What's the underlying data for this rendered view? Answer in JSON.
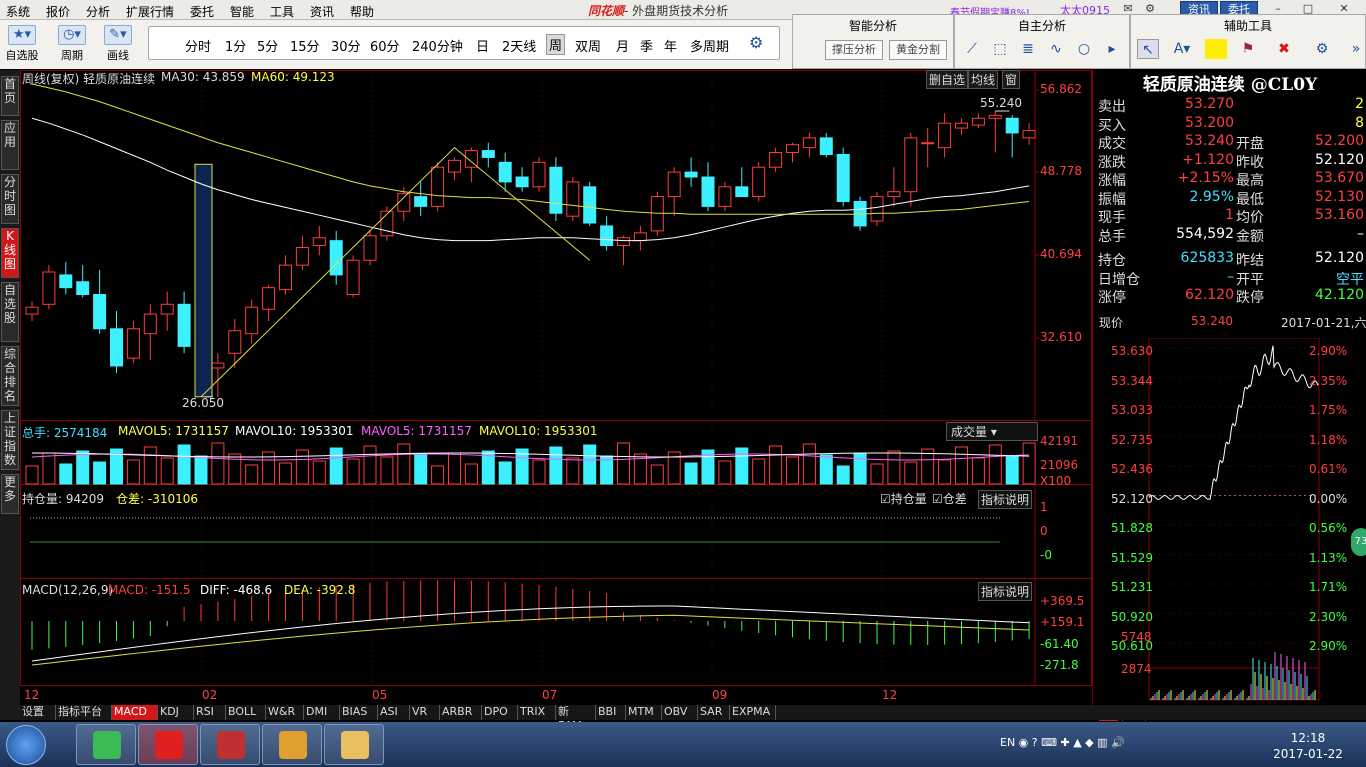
{
  "menubar": {
    "items": [
      "系统",
      "报价",
      "分析",
      "扩展行情",
      "委托",
      "智能",
      "工具",
      "资讯",
      "帮助"
    ],
    "app_logo": "同花顺",
    "app_title": "- 外盘期货技术分析",
    "promo": "春节假期宝赚8%!",
    "user": "太太0915",
    "btn_news": "资讯",
    "btn_trade": "委托"
  },
  "toolbar": {
    "tools": [
      {
        "label": "自选股"
      },
      {
        "label": "周期"
      },
      {
        "label": "画线"
      }
    ],
    "periods": [
      "分时",
      "1分",
      "5分",
      "15分",
      "30分",
      "60分",
      "240分钟",
      "日",
      "2天线",
      "周",
      "双周",
      "月",
      "季",
      "年",
      "多周期"
    ],
    "selected_period": "周",
    "smart_title": "智能分析",
    "smart_btns": [
      "撑压分析",
      "黄金分割"
    ],
    "custom_title": "自主分析",
    "aux_title": "辅助工具"
  },
  "lefttabs": [
    "首页",
    "应用",
    "分时图",
    "K线图",
    "自选股",
    "综合排名",
    "上证指数",
    "更多"
  ],
  "kline": {
    "header": "周线(复权)  轻质原油连续  MA30: 43.859",
    "ma30": "MA30: 43.859",
    "ma60": "MA60: 49.123",
    "title_prefix": "周线(复权)  轻质原油连续",
    "btn_fav": "删自选",
    "btn_avg": "均线",
    "btn_win": "窗",
    "yticks": [
      "56.862",
      "48.778",
      "40.694",
      "32.610"
    ],
    "high_label": "55.240",
    "low_label": "26.050",
    "xlabels": [
      "12",
      "02",
      "05",
      "07",
      "09",
      "12"
    ]
  },
  "volume": {
    "total": "总手: 2574184",
    "mavol5": "MAVOL5: 1731157",
    "mavol10": "MAVOL10: 1953301",
    "mavol5b": "MAVOL5: 1731157",
    "mavol10b": "MAVOL10: 1953301",
    "selector": "成交量",
    "yticks": [
      "42191",
      "21096",
      "X100"
    ]
  },
  "oi": {
    "label": "持仓量: 94209",
    "diff": "仓差: -310106",
    "chk1": "持仓量",
    "chk2": "仓差",
    "explain": "指标说明",
    "yticks": [
      "1",
      "0",
      "-0"
    ]
  },
  "macd": {
    "title": "MACD(12,26,9)",
    "macd": "MACD: -151.5",
    "diff": "DIFF: -468.6",
    "dea": "DEA: -392.8",
    "explain": "指标说明",
    "yticks": [
      "+369.5",
      "+159.1",
      "-61.40",
      "-271.8"
    ]
  },
  "quote": {
    "title": "轻质原油连续 @CL0Y",
    "rows": [
      {
        "l": "卖出",
        "v": "53.270",
        "r": "",
        "rv": "2",
        "vc": "#ff4040",
        "rc": "#ffff40"
      },
      {
        "l": "买入",
        "v": "53.200",
        "r": "",
        "rv": "8",
        "vc": "#ff4040",
        "rc": "#ffff40"
      },
      {
        "l": "成交",
        "v": "53.240",
        "r": "开盘",
        "rv": "52.200",
        "vc": "#ff4040",
        "rc": "#ff4040"
      },
      {
        "l": "涨跌",
        "v": "+1.120",
        "r": "昨收",
        "rv": "52.120",
        "vc": "#ff4040",
        "rc": "#ffffff"
      },
      {
        "l": "涨幅",
        "v": "+2.15%",
        "r": "最高",
        "rv": "53.670",
        "vc": "#ff4040",
        "rc": "#ff4040"
      },
      {
        "l": "振幅",
        "v": "2.95%",
        "r": "最低",
        "rv": "52.130",
        "vc": "#40e0ff",
        "rc": "#ff4040"
      },
      {
        "l": "现手",
        "v": "1",
        "r": "均价",
        "rv": "53.160",
        "vc": "#ff4040",
        "rc": "#ff4040"
      },
      {
        "l": "总手",
        "v": "554,592",
        "r": "金额",
        "rv": "–",
        "vc": "#ffffff",
        "rc": "#ffffff"
      },
      {
        "l": "持仓",
        "v": "625833",
        "r": "昨结",
        "rv": "52.120",
        "vc": "#40e0ff",
        "rc": "#ffffff"
      },
      {
        "l": "日增仓",
        "v": "–",
        "r": "开平",
        "rv": "空平",
        "vc": "#40e0ff",
        "rc": "#40e0ff"
      },
      {
        "l": "涨停",
        "v": "62.120",
        "r": "跌停",
        "rv": "42.120",
        "vc": "#ff4040",
        "rc": "#40ff40"
      }
    ],
    "now_label": "现价",
    "now_value": "53.240",
    "date": "2017-01-21,六",
    "price_ticks": [
      "53.630",
      "53.344",
      "53.033",
      "52.735",
      "52.436",
      "52.120",
      "51.828",
      "51.529",
      "51.231",
      "50.920",
      "50.610"
    ],
    "pct_ticks": [
      "2.90%",
      "2.35%",
      "1.75%",
      "1.18%",
      "0.61%",
      "0.00%",
      "0.56%",
      "1.13%",
      "1.71%",
      "2.30%",
      "2.90%"
    ],
    "vol_ticks": [
      "5748",
      "2874"
    ],
    "badge": "73",
    "tabs": [
      "分",
      "筹",
      "焰"
    ]
  },
  "bottomtabs": [
    "设置",
    "指标平台",
    "MACD",
    "KDJ",
    "RSI",
    "BOLL",
    "W&R",
    "DMI",
    "BIAS",
    "ASI",
    "VR",
    "ARBR",
    "DPO",
    "TRIX",
    "新DMA",
    "BBI",
    "MTM",
    "OBV",
    "SAR",
    "EXPMA"
  ],
  "selected_tab": "MACD",
  "taskbar": {
    "time": "12:18",
    "date": "2017-01-22",
    "lang": "EN"
  },
  "chart_data": {
    "type": "candlestick",
    "period": "weekly",
    "symbol": "轻质原油连续",
    "yrange": [
      24.5,
      58
    ],
    "ohlc": [
      [
        34.5,
        35.8,
        33.8,
        35.2
      ],
      [
        35.5,
        39.5,
        35.0,
        38.8
      ],
      [
        38.5,
        39.8,
        36.5,
        37.2
      ],
      [
        37.8,
        39.5,
        36.2,
        36.5
      ],
      [
        36.5,
        39.0,
        32.5,
        33.0
      ],
      [
        33.0,
        34.8,
        28.5,
        29.2
      ],
      [
        30.0,
        33.8,
        29.5,
        33.0
      ],
      [
        32.5,
        35.5,
        29.8,
        34.5
      ],
      [
        34.5,
        36.8,
        32.8,
        35.5
      ],
      [
        35.5,
        36.8,
        30.5,
        31.2
      ],
      [
        31.0,
        32.5,
        27.5,
        28.5
      ],
      [
        29.0,
        30.5,
        26.05,
        29.5
      ],
      [
        30.5,
        34.0,
        29.0,
        32.8
      ],
      [
        32.5,
        36.0,
        31.5,
        35.2
      ],
      [
        35.0,
        37.5,
        33.8,
        37.2
      ],
      [
        37.0,
        40.5,
        36.5,
        39.5
      ],
      [
        39.5,
        42.5,
        39.0,
        41.3
      ],
      [
        41.5,
        43.5,
        40.5,
        42.3
      ],
      [
        42.0,
        43.0,
        37.5,
        38.5
      ],
      [
        36.5,
        40.5,
        36.2,
        40.0
      ],
      [
        40.0,
        43.0,
        39.5,
        42.5
      ],
      [
        42.5,
        45.5,
        42.0,
        45.0
      ],
      [
        45.0,
        47.5,
        44.0,
        46.8
      ],
      [
        46.5,
        48.0,
        44.5,
        45.5
      ],
      [
        45.5,
        50.0,
        45.0,
        49.5
      ],
      [
        49.0,
        50.5,
        48.2,
        50.2
      ],
      [
        49.5,
        51.5,
        48.0,
        51.2
      ],
      [
        51.2,
        52.0,
        49.5,
        50.5
      ],
      [
        50.0,
        51.0,
        47.0,
        48.0
      ],
      [
        48.5,
        49.5,
        47.0,
        47.5
      ],
      [
        47.5,
        50.5,
        47.0,
        50.0
      ],
      [
        49.5,
        50.5,
        44.0,
        44.8
      ],
      [
        44.5,
        48.5,
        44.0,
        48.0
      ],
      [
        47.5,
        48.0,
        43.5,
        43.8
      ],
      [
        43.5,
        44.5,
        41.0,
        41.5
      ],
      [
        41.5,
        42.5,
        39.5,
        42.3
      ],
      [
        42.0,
        43.5,
        41.0,
        42.8
      ],
      [
        43.0,
        47.0,
        42.5,
        46.5
      ],
      [
        46.5,
        49.5,
        44.5,
        49.0
      ],
      [
        49.0,
        50.5,
        47.5,
        48.5
      ],
      [
        48.5,
        50.0,
        45.0,
        45.5
      ],
      [
        45.5,
        48.0,
        45.0,
        47.5
      ],
      [
        47.5,
        49.5,
        46.5,
        46.5
      ],
      [
        46.5,
        50.0,
        46.0,
        49.5
      ],
      [
        49.5,
        51.5,
        49.0,
        51.0
      ],
      [
        51.0,
        52.0,
        50.0,
        51.8
      ],
      [
        51.5,
        53.0,
        50.5,
        52.5
      ],
      [
        52.5,
        53.0,
        50.5,
        50.8
      ],
      [
        50.8,
        51.5,
        45.5,
        46.0
      ],
      [
        46.0,
        46.5,
        43.0,
        43.5
      ],
      [
        44.0,
        47.0,
        43.5,
        46.5
      ],
      [
        46.5,
        49.5,
        45.5,
        47.0
      ],
      [
        47.0,
        53.0,
        45.5,
        52.5
      ],
      [
        52.0,
        53.5,
        49.5,
        52.0
      ],
      [
        51.5,
        55.0,
        50.5,
        54.0
      ],
      [
        53.5,
        54.5,
        52.8,
        54.0
      ],
      [
        53.8,
        55.0,
        53.5,
        54.5
      ],
      [
        54.5,
        55.24,
        51.0,
        54.8
      ],
      [
        54.5,
        54.8,
        50.5,
        53.0
      ],
      [
        52.5,
        54.0,
        51.8,
        53.24
      ]
    ],
    "ma30": [
      54.5,
      54.0,
      53.4,
      52.8,
      52.1,
      51.4,
      50.7,
      50.0,
      49.2,
      48.5,
      47.8,
      47.2,
      46.7,
      46.2,
      45.8,
      45.4,
      45.0,
      44.6,
      44.2,
      43.8,
      43.4,
      43.0,
      42.6,
      42.3,
      42.1,
      42.0,
      42.0,
      42.0,
      42.1,
      42.2,
      42.3,
      42.3,
      42.3,
      42.2,
      42.1,
      42.0,
      42.0,
      42.1,
      42.3,
      42.6,
      43.0,
      43.4,
      43.8,
      44.2,
      44.5,
      44.8,
      45.0,
      45.1,
      45.1,
      45.2,
      45.4,
      45.7,
      46.0,
      46.3,
      46.5,
      46.6,
      46.8,
      47.0,
      47.3,
      47.6
    ],
    "ma60": [
      58.0,
      57.6,
      57.2,
      56.7,
      56.2,
      55.6,
      55.0,
      54.4,
      53.8,
      53.2,
      52.6,
      52.0,
      51.5,
      51.0,
      50.5,
      50.0,
      49.5,
      49.0,
      48.5,
      48.0,
      47.6,
      47.3,
      47.0,
      46.8,
      46.6,
      46.5,
      46.4,
      46.4,
      46.3,
      46.2,
      46.0,
      45.8,
      45.6,
      45.4,
      45.2,
      45.0,
      44.9,
      44.8,
      44.8,
      44.7,
      44.7,
      44.7,
      44.7,
      44.7,
      44.7,
      44.7,
      44.7,
      44.7,
      44.7,
      44.7,
      44.8,
      44.8,
      44.9,
      45.0,
      45.1,
      45.2,
      45.4,
      45.6,
      45.8,
      46.0
    ]
  }
}
